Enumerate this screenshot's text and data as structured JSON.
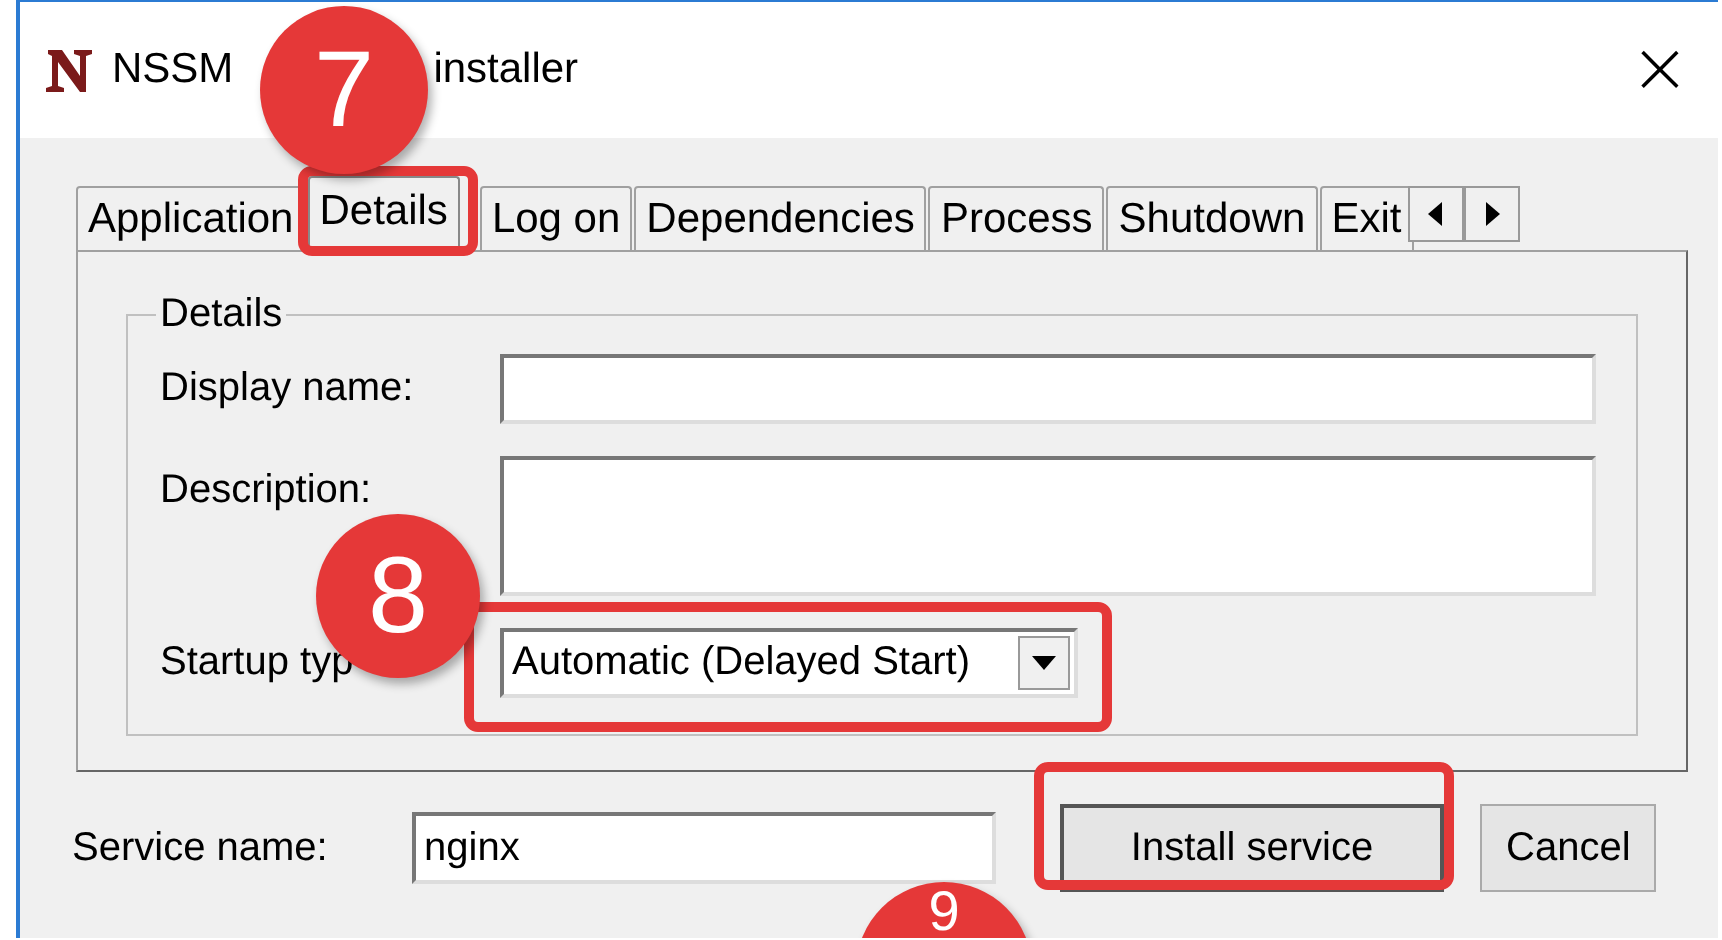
{
  "window": {
    "title_start": "NSSM",
    "title_end": "installer",
    "close": "×"
  },
  "tabs": [
    {
      "label": "Application",
      "selected": false
    },
    {
      "label": "Details",
      "selected": true
    },
    {
      "label": "Log on",
      "selected": false
    },
    {
      "label": "Dependencies",
      "selected": false
    },
    {
      "label": "Process",
      "selected": false
    },
    {
      "label": "Shutdown",
      "selected": false
    },
    {
      "label": "Exit",
      "selected": false
    }
  ],
  "group": {
    "title": "Details",
    "fields": [
      {
        "kind": "text",
        "label": "Display name:"
      },
      {
        "kind": "textarea",
        "label": "Description:"
      },
      {
        "kind": "combo",
        "label": "Startup typ",
        "value": "Automatic (Delayed Start)"
      }
    ]
  },
  "service_name": {
    "label": "Service name:",
    "value": "nginx"
  },
  "buttons": [
    {
      "label": "Install service",
      "default": true
    },
    {
      "label": "Cancel",
      "default": false
    }
  ],
  "annotations": [
    {
      "label": "7"
    },
    {
      "label": "8"
    },
    {
      "label": "9"
    }
  ]
}
